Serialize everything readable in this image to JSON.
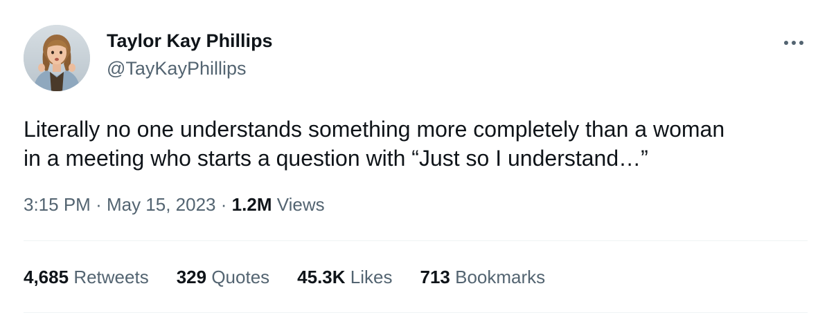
{
  "author": {
    "name": "Taylor Kay Phillips",
    "handle": "@TayKayPhillips",
    "avatar_icon": "user-avatar-photo"
  },
  "more_icon": "ellipsis-icon",
  "tweet": {
    "text": "Literally no one understands something more completely than a woman\nin a meeting who starts a question with “Just so I understand…”",
    "time": "3:15 PM",
    "separator": "·",
    "date": "May 15, 2023",
    "views_count": "1.2M",
    "views_label": "Views"
  },
  "stats": [
    {
      "count": "4,685",
      "label": "Retweets"
    },
    {
      "count": "329",
      "label": "Quotes"
    },
    {
      "count": "45.3K",
      "label": "Likes"
    },
    {
      "count": "713",
      "label": "Bookmarks"
    }
  ],
  "colors": {
    "text_primary": "#0f1419",
    "text_secondary": "#536471",
    "divider": "#eff3f4",
    "background": "#ffffff"
  }
}
